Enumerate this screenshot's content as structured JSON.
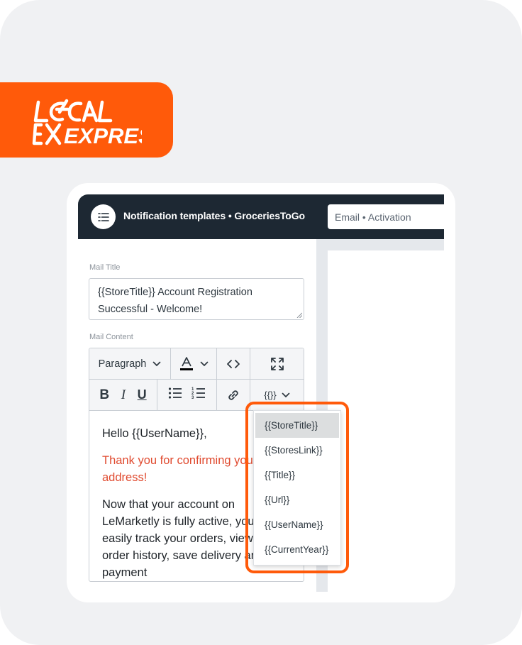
{
  "brand": {
    "logo_text_line1": "LOCAL",
    "logo_text_line2": "EXPRESS",
    "color": "#ff5a0a"
  },
  "header": {
    "menu_icon": "list-icon",
    "title": "Notification templates • GroceriesToGo",
    "template_select_value": "Email • Activation"
  },
  "form": {
    "mail_title_label": "Mail Title",
    "mail_title_value": "{{StoreTitle}} Account Registration Successful - Welcome!",
    "mail_content_label": "Mail Content"
  },
  "toolbar": {
    "row1": [
      {
        "name": "paragraph-format-dropdown",
        "label": "Paragraph",
        "icon": "chevron-down-icon"
      },
      {
        "name": "text-color-dropdown",
        "icon": "font-color-icon"
      },
      {
        "name": "code-view-button",
        "icon": "code-icon"
      },
      {
        "name": "fullscreen-button",
        "icon": "expand-icon"
      }
    ],
    "row2": [
      {
        "name": "bold-button",
        "icon": "bold-icon"
      },
      {
        "name": "italic-button",
        "icon": "italic-icon"
      },
      {
        "name": "underline-button",
        "icon": "underline-icon"
      },
      {
        "name": "bulleted-list-button",
        "icon": "bulleted-list-icon"
      },
      {
        "name": "numbered-list-button",
        "icon": "numbered-list-icon"
      },
      {
        "name": "link-button",
        "icon": "link-icon"
      },
      {
        "name": "placeholder-dropdown",
        "label": "{{}}",
        "icon": "chevron-down-icon"
      }
    ],
    "font_color_accent": "#000000"
  },
  "editor_body": {
    "greeting": "Hello {{UserName}},",
    "highlight": "Thank you for confirming your email address!",
    "paragraph": "Now that your account on LeMarketly is fully active, you can easily track your orders, view your order history, save delivery and payment",
    "highlight_color": "#e04a2f"
  },
  "placeholder_menu": {
    "items": [
      "{{StoreTitle}}",
      "{{StoresLink}}",
      "{{Title}}",
      "{{Url}}",
      "{{UserName}}",
      "{{CurrentYear}}"
    ],
    "active_index": 0,
    "highlight_color": "#ff5a0a"
  }
}
